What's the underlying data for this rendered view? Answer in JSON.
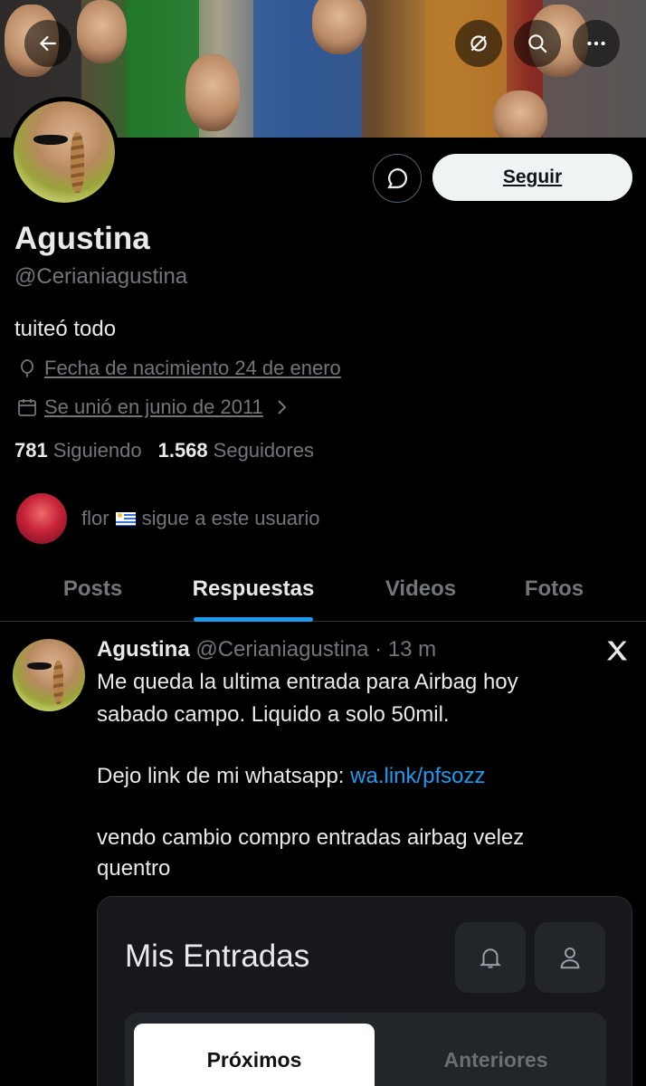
{
  "profile": {
    "name": "Agustina",
    "handle": "@Cerianiagustina",
    "bio": "tuiteó todo",
    "birthday": "Fecha de nacimiento 24 de enero",
    "joined": "Se unió en junio de 2011",
    "following_count": "781",
    "following_label": "Siguiendo",
    "followers_count": "1.568",
    "followers_label": "Seguidores",
    "follow_button": "Seguir"
  },
  "followed_by": {
    "name": "flor",
    "text": "sigue a este usuario"
  },
  "tabs": [
    {
      "label": "Posts",
      "active": false
    },
    {
      "label": "Respuestas",
      "active": true
    },
    {
      "label": "Videos",
      "active": false
    },
    {
      "label": "Fotos",
      "active": false
    }
  ],
  "tweet": {
    "author": "Agustina",
    "handle": "@Cerianiagustina",
    "time": "· 13 m",
    "line1": "Me queda la ultima entrada para Airbag hoy",
    "line2": "sabado campo. Liquido a solo 50mil.",
    "line3_prefix": "Dejo link de mi whatsapp: ",
    "link": "wa.link/pfsozz",
    "line4": "vendo cambio compro entradas airbag velez",
    "line5": "quentro"
  },
  "media": {
    "title": "Mis Entradas",
    "tab_active": "Próximos",
    "tab_inactive": "Anteriores"
  },
  "icons": {
    "back": "back-arrow-icon",
    "grok": "grok-icon",
    "search": "search-icon",
    "more": "more-icon",
    "message": "message-icon",
    "location": "balloon-icon",
    "calendar": "calendar-icon",
    "x_logo": "x-logo-icon",
    "bell": "bell-icon",
    "user": "user-icon"
  },
  "colors": {
    "background": "#000000",
    "accent": "#1d9bf0",
    "muted": "#71767b",
    "text": "#e7e9ea"
  }
}
